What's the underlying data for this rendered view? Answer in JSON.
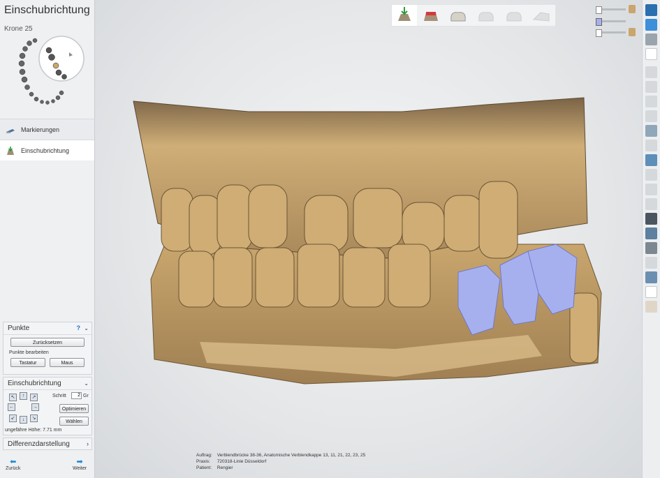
{
  "app": {
    "title": "Einschubrichtung",
    "subtitle": "Krone 25"
  },
  "steps": [
    {
      "label": "Markierungen"
    },
    {
      "label": "Einschubrichtung"
    }
  ],
  "punkte": {
    "header": "Punkte",
    "help": "?",
    "reset_label": "Zurücksetzen",
    "edit_label": "Punkte bearbeiten",
    "keyboard_label": "Tastatur",
    "mouse_label": "Maus"
  },
  "insertion": {
    "header": "Einschubrichtung",
    "step_label": "Schritt",
    "step_value": "2",
    "unit": "Gr",
    "optimize_label": "Optimieren",
    "select_label": "Wählen",
    "height_label": "ungefähre Höhe:",
    "height_value": "7.71 mm"
  },
  "diff": {
    "header": "Differenzdarstellung"
  },
  "nav": {
    "back": "Zurück",
    "next": "Weiter"
  },
  "info": {
    "order_key": "Auftrag:",
    "order_value": "Verblendbrücke 38-36, Anatomische Verblendkappe 13, 11, 21, 22, 23, 25",
    "practice_key": "Praxis:",
    "practice_value": "720318-Linie Düsseldorf",
    "patient_key": "Patient:",
    "patient_value": "Rengier"
  },
  "colors": {
    "tooth": "#c9a66d",
    "prep": "#9ea7e8",
    "accent": "#1f8ad6"
  }
}
